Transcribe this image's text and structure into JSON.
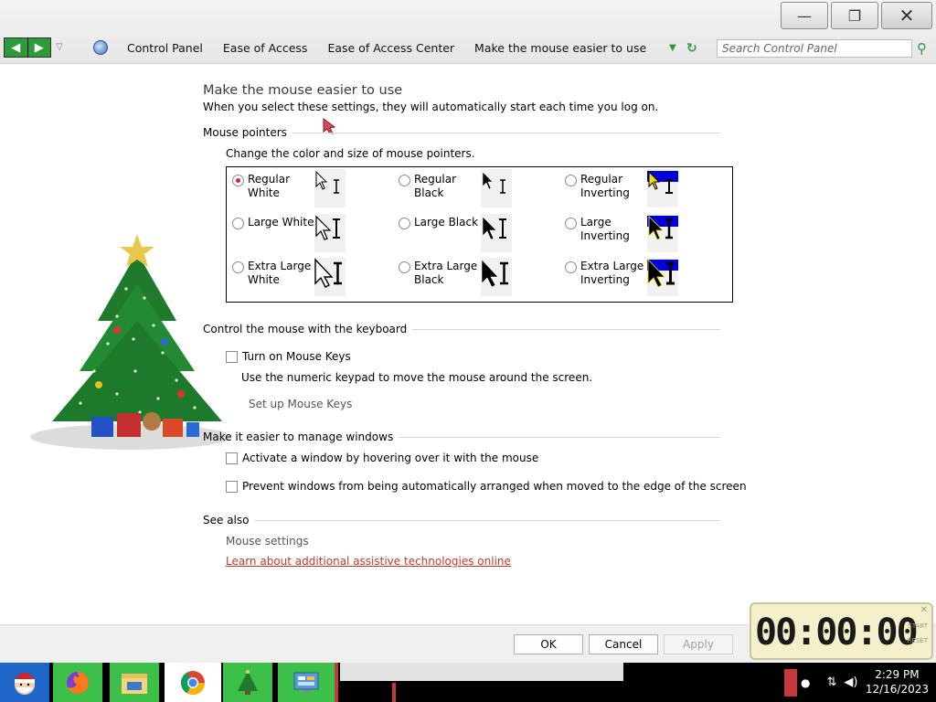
{
  "window": {
    "minimize_glyph": "—",
    "restore_glyph": "❐",
    "close_glyph": "✕"
  },
  "address_bar": {
    "breadcrumbs": [
      "Control Panel",
      "Ease of Access",
      "Ease of Access Center",
      "Make the mouse easier to use"
    ],
    "search_placeholder": "Search Control Panel"
  },
  "page": {
    "title": "Make the mouse easier to use",
    "subtitle": "When you select these settings, they will automatically start each time you log on."
  },
  "mouse_pointers": {
    "heading": "Mouse pointers",
    "description": "Change the color and size of mouse pointers.",
    "options": [
      {
        "label": "Regular White",
        "selected": true
      },
      {
        "label": "Regular Black",
        "selected": false
      },
      {
        "label": "Regular Inverting",
        "selected": false
      },
      {
        "label": "Large White",
        "selected": false
      },
      {
        "label": "Large Black",
        "selected": false
      },
      {
        "label": "Large Inverting",
        "selected": false
      },
      {
        "label": "Extra Large White",
        "selected": false
      },
      {
        "label": "Extra Large Black",
        "selected": false
      },
      {
        "label": "Extra Large Inverting",
        "selected": false
      }
    ]
  },
  "keyboard": {
    "heading": "Control the mouse with the keyboard",
    "mouse_keys_label": "Turn on Mouse Keys",
    "mouse_keys_checked": false,
    "mouse_keys_desc": "Use the numeric keypad to move the mouse around the screen.",
    "setup_link": "Set up Mouse Keys"
  },
  "windows": {
    "heading": "Make it easier to manage windows",
    "hover_label": "Activate a window by hovering over it with the mouse",
    "hover_checked": false,
    "snap_label": "Prevent windows from being automatically arranged when moved to the edge of the screen",
    "snap_checked": false
  },
  "see_also": {
    "heading": "See also",
    "mouse_settings": "Mouse settings",
    "assistive_link": "Learn about additional assistive technologies online"
  },
  "buttons": {
    "ok": "OK",
    "cancel": "Cancel",
    "apply": "Apply"
  },
  "timer": {
    "display": "00:00:00",
    "start_label": "START",
    "reset_label": "RESET"
  },
  "taskbar": {
    "time": "2:29 PM",
    "date": "12/16/2023"
  },
  "colors": {
    "accent_green": "#2e9b3a",
    "link_red": "#c03a2b",
    "radio_selected": "#d0263b",
    "inverting_blue": "#0000d8",
    "inverting_yellow": "#f0e000"
  }
}
